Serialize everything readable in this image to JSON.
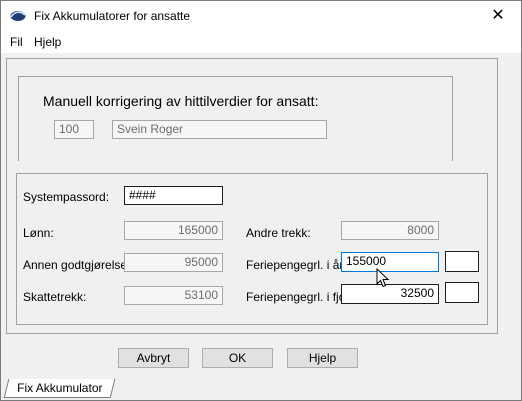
{
  "window": {
    "title": "Fix Akkumulatorer for ansatte",
    "close": "✕"
  },
  "menu": [
    "Fil",
    "Hjelp"
  ],
  "heading": "Manuell korrigering av hittilverdier for ansatt:",
  "employee": {
    "number": "100",
    "name": "Svein Roger"
  },
  "fields": {
    "systempassord": {
      "label": "Systempassord:",
      "value": "####"
    },
    "lonn": {
      "label": "Lønn:",
      "value": "165000"
    },
    "annen": {
      "label": "Annen godtgjørelse:",
      "value": "95000"
    },
    "skatt": {
      "label": "Skattetrekk:",
      "value": "53100"
    },
    "andre": {
      "label": "Andre trekk:",
      "value": "8000"
    },
    "ferie_aar": {
      "label": "Feriepengegrl. i år:",
      "value": "155000"
    },
    "ferie_fjor": {
      "label": "Feriepengegrl. i fjor:",
      "value": "32500"
    }
  },
  "buttons": {
    "cancel": "Avbryt",
    "ok": "OK",
    "help": "Hjelp"
  },
  "tab": "Fix Akkumulator"
}
